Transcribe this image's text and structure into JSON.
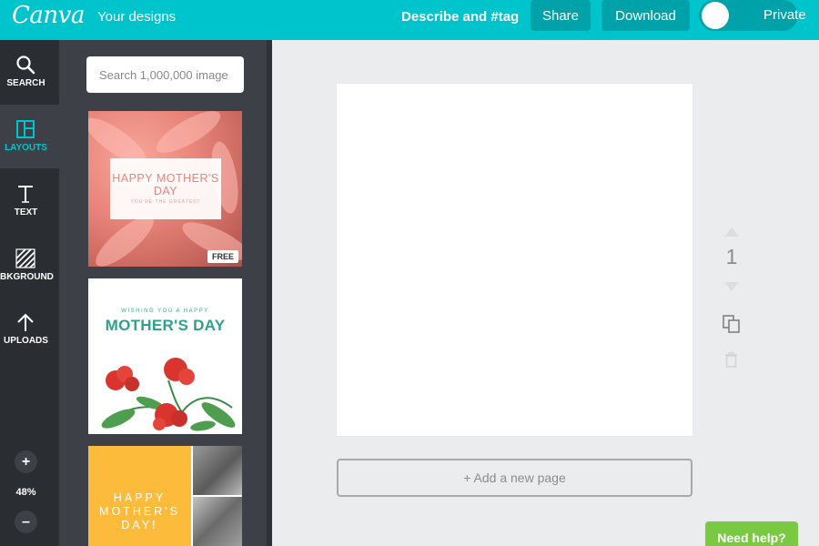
{
  "header": {
    "logo": "Canva",
    "your_designs": "Your designs",
    "describe_tag": "Describe and #tag",
    "share_label": "Share",
    "download_label": "Download",
    "privacy_label": "Private",
    "accent_color": "#00c4cc"
  },
  "sidebar": {
    "items": [
      {
        "label": "SEARCH",
        "icon": "search-icon"
      },
      {
        "label": "LAYOUTS",
        "icon": "layouts-icon",
        "active": true
      },
      {
        "label": "TEXT",
        "icon": "text-icon"
      },
      {
        "label": "BKGROUND",
        "icon": "background-icon"
      },
      {
        "label": "UPLOADS",
        "icon": "upload-icon"
      }
    ],
    "zoom_in": "+",
    "zoom_level": "48%",
    "zoom_out": "–"
  },
  "panel": {
    "search_placeholder": "Search 1,000,000 image",
    "templates": [
      {
        "title": "HAPPY MOTHER'S DAY",
        "subtitle": "YOU'RE THE GREATEST",
        "badge": "FREE"
      },
      {
        "subtitle": "WISHING YOU A HAPPY",
        "title": "MOTHER'S DAY"
      },
      {
        "title": "HAPPY MOTHER'S DAY!"
      }
    ]
  },
  "canvas": {
    "page_number": "1",
    "add_page_label": "+ Add a new page"
  },
  "help": {
    "label": "Need help?"
  }
}
